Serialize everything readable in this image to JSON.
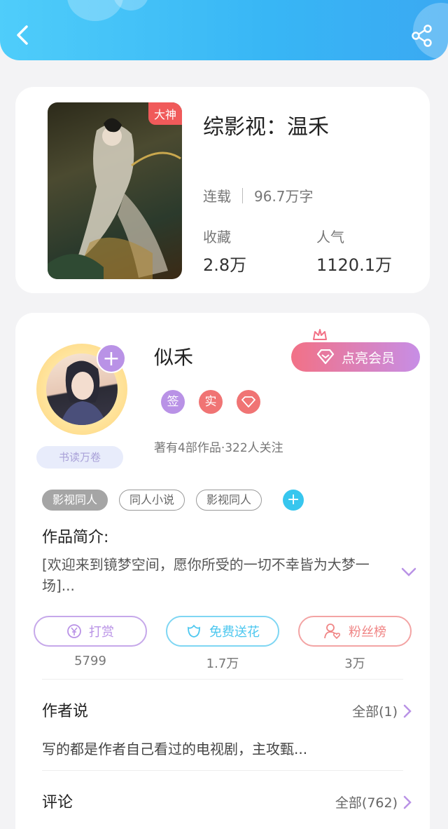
{
  "book": {
    "title": "综影视：温禾",
    "cover_badge": "大神",
    "status": "连载",
    "word_count": "96.7万字",
    "favorites_label": "收藏",
    "favorites_value": "2.8万",
    "popularity_label": "人气",
    "popularity_value": "1120.1万"
  },
  "author": {
    "name": "似禾",
    "vip_button": "点亮会员",
    "badges": [
      "签",
      "实"
    ],
    "stats": "著有4部作品·322人关注",
    "scholar_badge": "书读万卷",
    "tags": [
      "影视同人",
      "同人小说",
      "影视同人"
    ]
  },
  "intro": {
    "heading": "作品简介:",
    "text": "[欢迎来到镜梦空间，愿你所受的一切不幸皆为大梦一场]..."
  },
  "actions": [
    {
      "label": "打赏",
      "count": "5799",
      "color": "#b992e6"
    },
    {
      "label": "免费送花",
      "count": "1.7万",
      "color": "#4cc7ef"
    },
    {
      "label": "粉丝榜",
      "count": "3万",
      "color": "#f08585"
    }
  ],
  "author_says": {
    "heading": "作者说",
    "more": "全部(1)",
    "text": "写的都是作者自己看过的电视剧，主攻甄..."
  },
  "comments": {
    "heading": "评论",
    "more": "全部(762)"
  },
  "colors": {
    "header": "#38b6f5",
    "accent_purple": "#b992e6",
    "accent_red": "#f05a5a"
  }
}
